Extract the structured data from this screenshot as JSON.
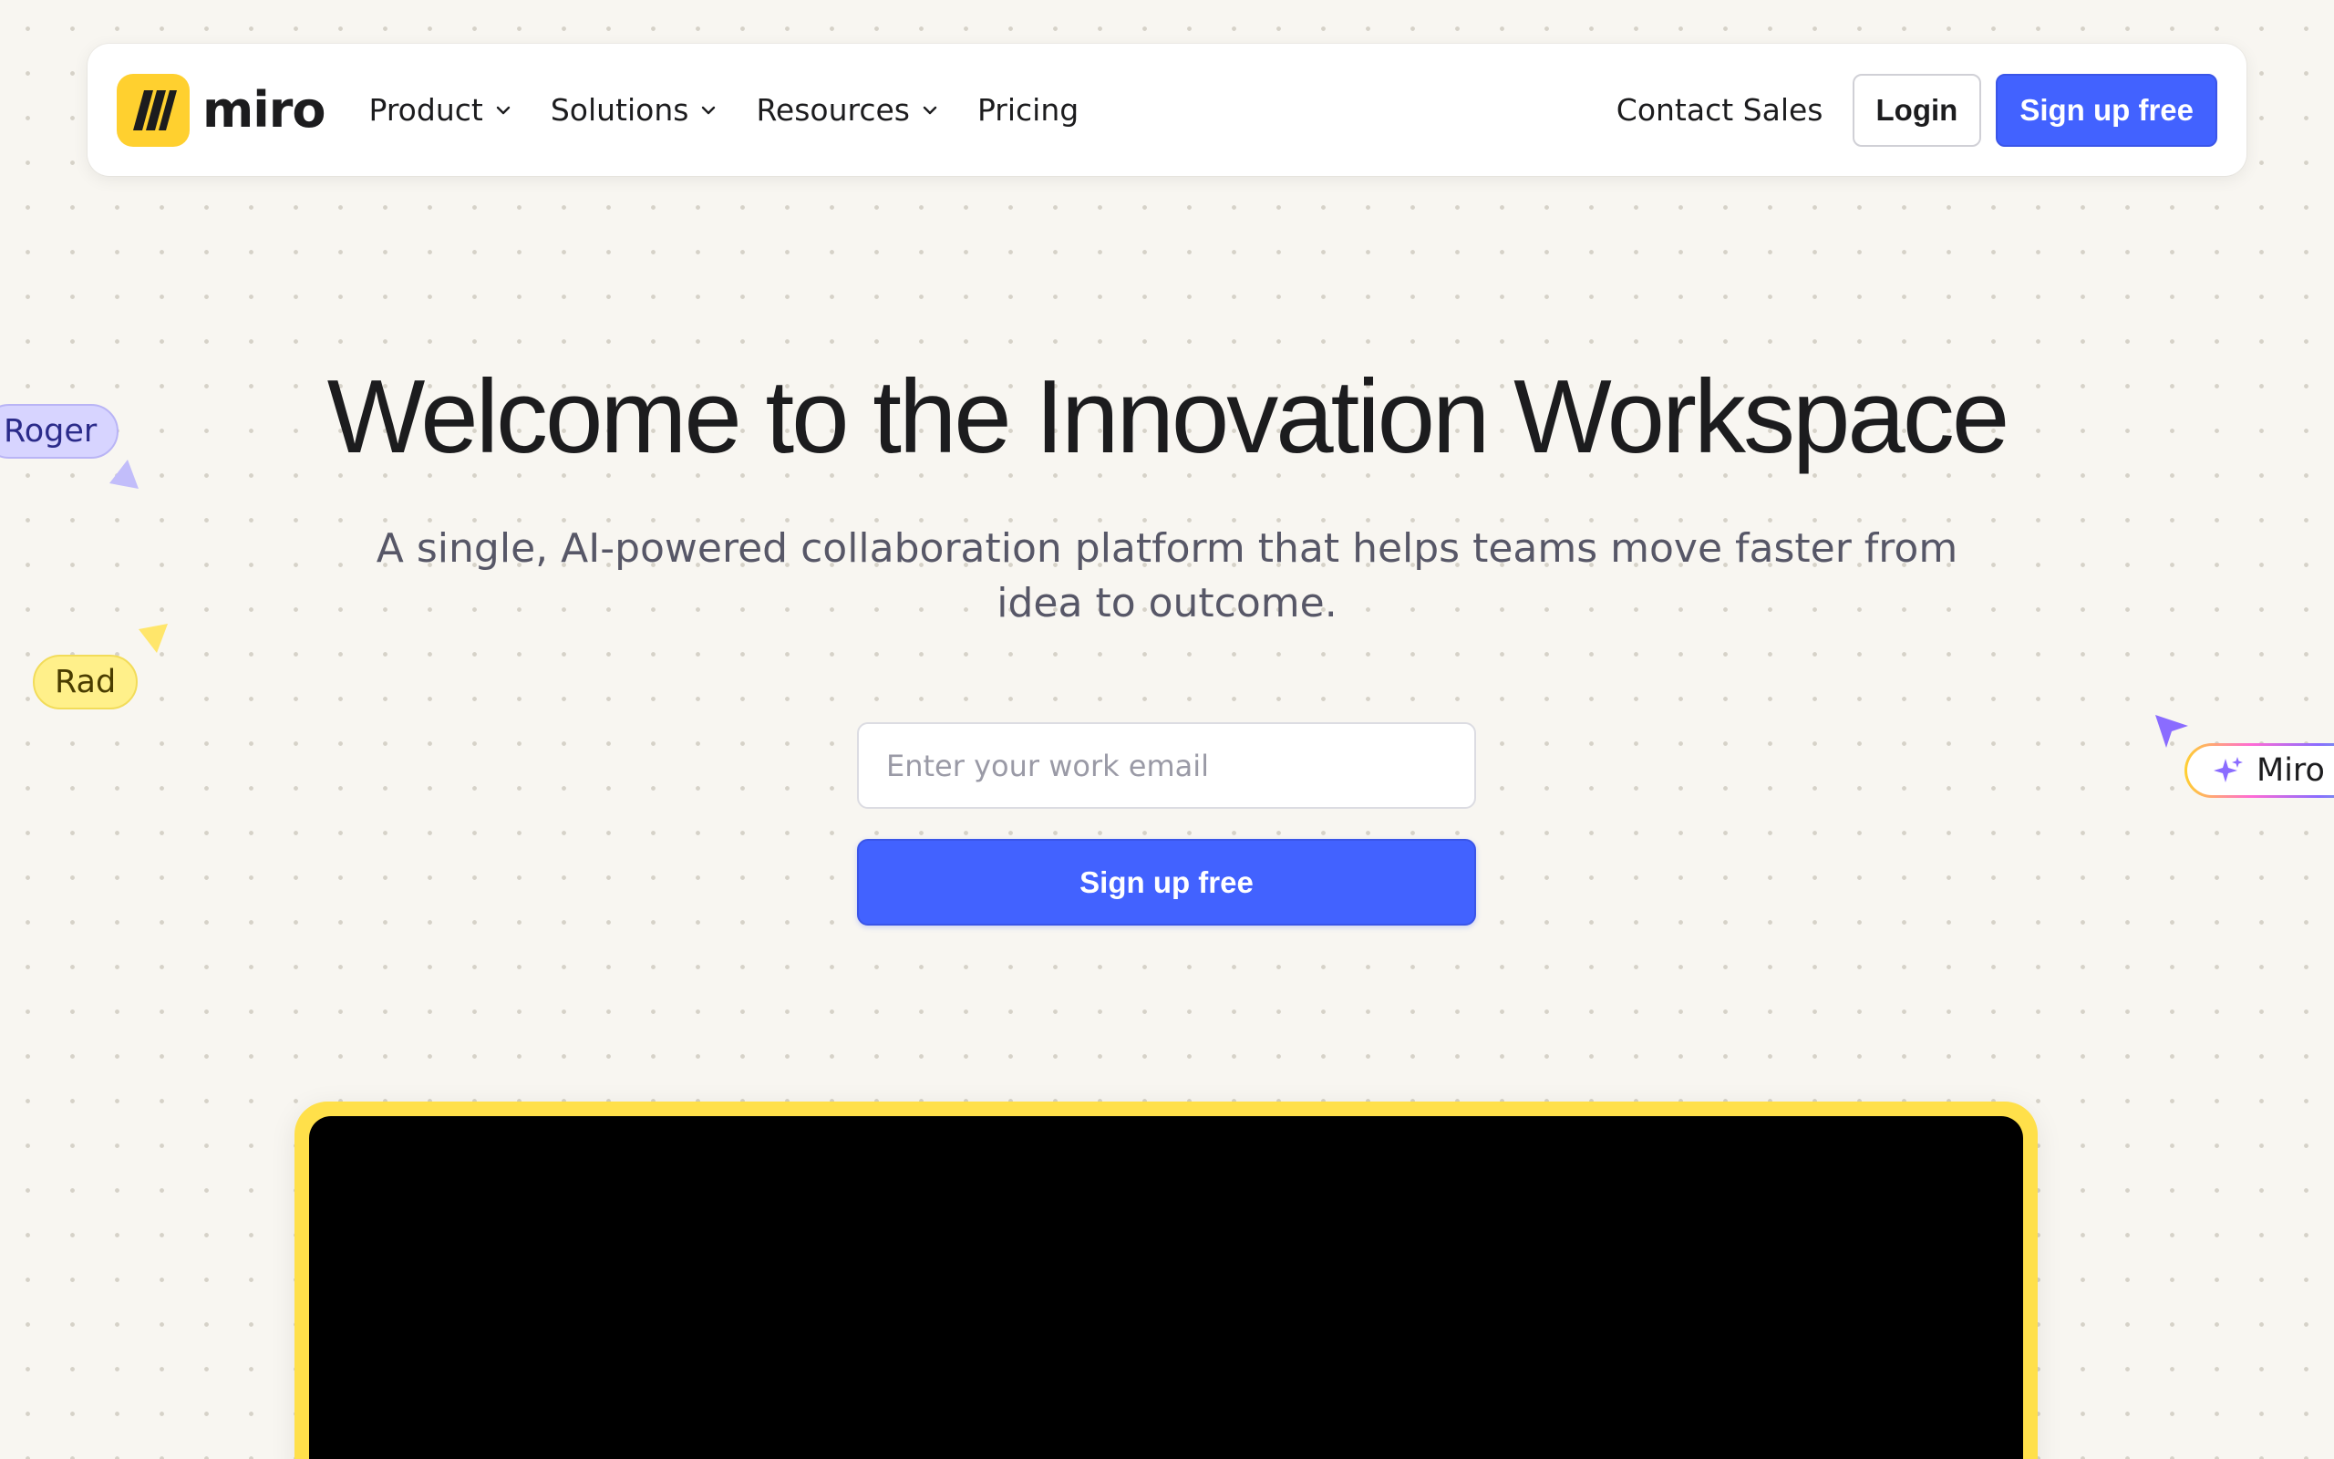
{
  "brand": {
    "name": "miro",
    "logo_color": "#ffd02f"
  },
  "nav": {
    "menu": [
      {
        "label": "Product",
        "has_dropdown": true
      },
      {
        "label": "Solutions",
        "has_dropdown": true
      },
      {
        "label": "Resources",
        "has_dropdown": true
      },
      {
        "label": "Pricing",
        "has_dropdown": false
      }
    ],
    "contact_label": "Contact Sales",
    "login_label": "Login",
    "signup_label": "Sign up free"
  },
  "hero": {
    "title": "Welcome to the Innovation Workspace",
    "subtitle": "A single, AI-powered collaboration platform that helps teams move faster from idea to outcome.",
    "email_placeholder": "Enter your work email",
    "email_value": "",
    "cta_label": "Sign up free"
  },
  "cursors": {
    "roger": "Roger",
    "rad": "Rad",
    "miro_ai": "Miro AI"
  },
  "colors": {
    "accent": "#4262ff",
    "background": "#f8f6f1",
    "video_frame": "#ffe04a"
  }
}
